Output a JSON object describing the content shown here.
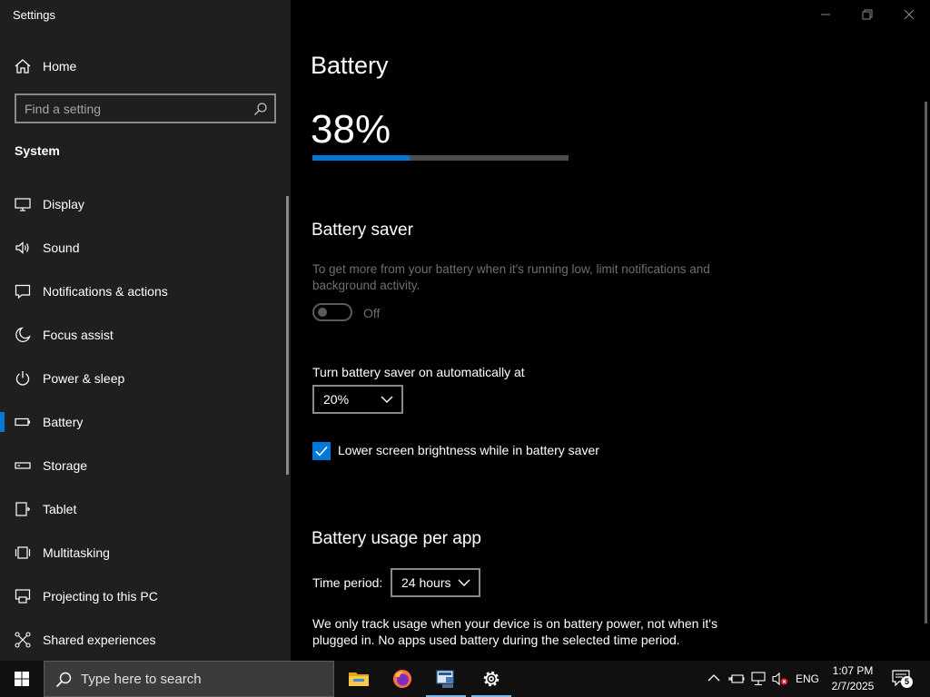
{
  "window": {
    "title": "Settings",
    "controls": [
      "minimize",
      "restore",
      "close"
    ]
  },
  "sidebar": {
    "home_label": "Home",
    "search_placeholder": "Find a setting",
    "section_title": "System",
    "items": [
      {
        "label": "Display",
        "icon": "display-icon"
      },
      {
        "label": "Sound",
        "icon": "sound-icon"
      },
      {
        "label": "Notifications & actions",
        "icon": "notifications-icon"
      },
      {
        "label": "Focus assist",
        "icon": "moon-icon"
      },
      {
        "label": "Power & sleep",
        "icon": "power-icon"
      },
      {
        "label": "Battery",
        "icon": "battery-icon",
        "selected": true
      },
      {
        "label": "Storage",
        "icon": "storage-icon"
      },
      {
        "label": "Tablet",
        "icon": "tablet-icon"
      },
      {
        "label": "Multitasking",
        "icon": "multitasking-icon"
      },
      {
        "label": "Projecting to this PC",
        "icon": "projecting-icon"
      },
      {
        "label": "Shared experiences",
        "icon": "shared-icon"
      }
    ]
  },
  "main": {
    "title": "Battery",
    "percent_text": "38%",
    "level": 0.38,
    "battery_saver": {
      "heading": "Battery saver",
      "description": "To get more from your battery when it's running low, limit notifications and background activity.",
      "toggle_state": "Off",
      "auto_label": "Turn battery saver on automatically at",
      "auto_value": "20%",
      "brightness_label": "Lower screen brightness while in battery saver",
      "brightness_checked": true
    },
    "usage": {
      "heading": "Battery usage per app",
      "period_label": "Time period:",
      "period_value": "24 hours",
      "note": "We only track usage when your device is on battery power, not when it's plugged in. No apps used battery during the selected time period."
    }
  },
  "taskbar": {
    "search_placeholder": "Type here to search",
    "apps": [
      "file-explorer-icon",
      "firefox-icon",
      "terminal-app-icon",
      "settings-gear-icon"
    ],
    "language": "ENG",
    "time": "1:07 PM",
    "date": "2/7/2025",
    "notification_count": "5"
  },
  "colors": {
    "accent": "#0078d7",
    "sidebar_bg": "#1f1f1f",
    "content_bg": "#000000",
    "taskbar_bg": "#101010"
  }
}
